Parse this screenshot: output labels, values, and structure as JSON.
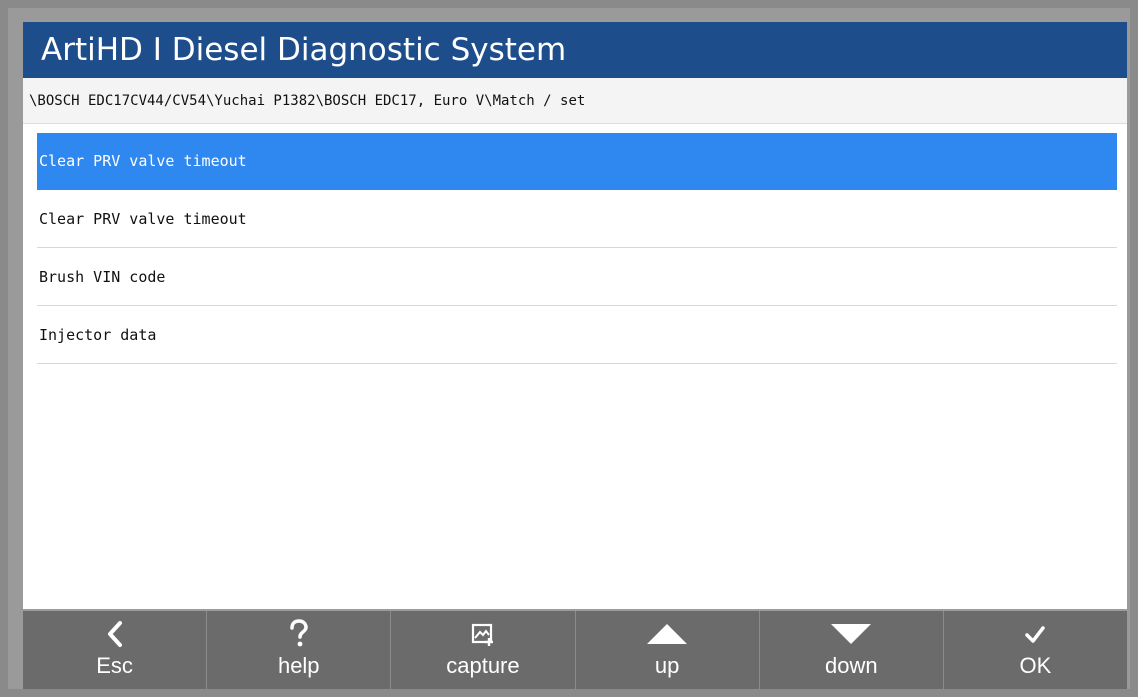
{
  "app": {
    "title": "ArtiHD I Diesel Diagnostic System"
  },
  "breadcrumb": {
    "path": "\\BOSCH EDC17CV44/CV54\\Yuchai P1382\\BOSCH EDC17, Euro V\\Match / set"
  },
  "menu": {
    "items": [
      {
        "label": "Clear PRV valve timeout",
        "selected": true
      },
      {
        "label": "Clear PRV valve timeout",
        "selected": false
      },
      {
        "label": "Brush VIN code",
        "selected": false
      },
      {
        "label": "Injector data",
        "selected": false
      }
    ]
  },
  "toolbar": {
    "buttons": [
      {
        "label": "Esc",
        "icon": "chevron-left-icon"
      },
      {
        "label": "help",
        "icon": "question-icon"
      },
      {
        "label": "capture",
        "icon": "screenshot-icon"
      },
      {
        "label": "up",
        "icon": "triangle-up-icon"
      },
      {
        "label": "down",
        "icon": "triangle-down-icon"
      },
      {
        "label": "OK",
        "icon": "checkmark-icon"
      }
    ]
  },
  "colors": {
    "title_bar": "#1e4d8c",
    "selected_row": "#2f87f0",
    "toolbar": "#6b6b6b"
  }
}
